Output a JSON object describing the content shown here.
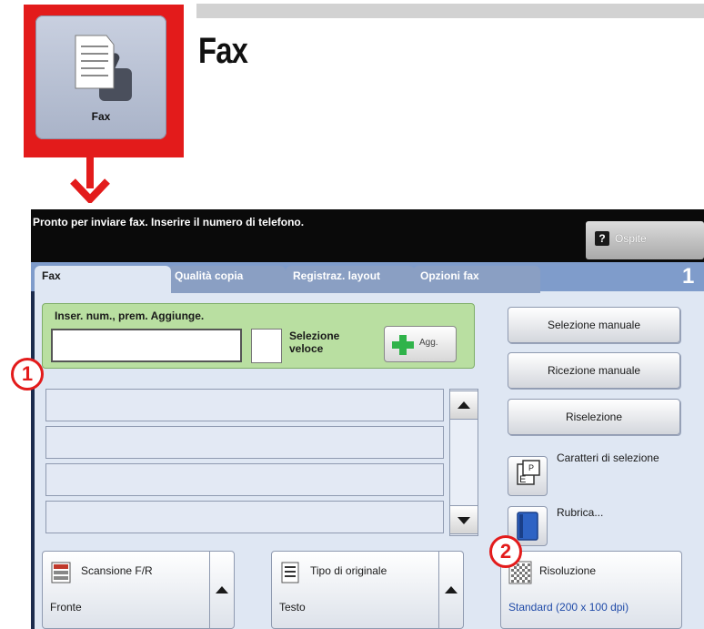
{
  "app_icon": {
    "label": "Fax"
  },
  "page_title": "Fax",
  "colors": {
    "callout": "#e31b1b",
    "tab_bar": "#7f9ccb",
    "entry_area": "#b9dfa1",
    "resolution_value": "#1f4aa8"
  },
  "status_bar": {
    "message": "Pronto per inviare fax. Inserire il numero di telefono.",
    "guest_icon": "question-mark-icon",
    "guest_label": "Ospite"
  },
  "tabs": [
    {
      "label": "Fax",
      "selected": true
    },
    {
      "label": "Qualità copia",
      "selected": false
    },
    {
      "label": "Registraz. layout",
      "selected": false
    },
    {
      "label": "Opzioni fax",
      "selected": false
    }
  ],
  "recipient_count": "1",
  "entry": {
    "label": "Inser. num., prem. Aggiunge.",
    "number_value": "",
    "speed_dial_label": "Selezione veloce",
    "add_button_label": "Agg."
  },
  "recipient_list": {
    "rows": [
      "",
      "",
      "",
      ""
    ]
  },
  "side_buttons": {
    "manual_dial": "Selezione manuale",
    "manual_receive": "Ricezione manuale",
    "redial": "Riselezione",
    "dial_characters": "Caratteri di selezione",
    "address_book": "Rubrica..."
  },
  "settings": [
    {
      "title": "Scansione F/R",
      "value": "Fronte"
    },
    {
      "title": "Tipo di originale",
      "value": "Testo"
    },
    {
      "title": "Risoluzione",
      "value": "Standard (200 x 100 dpi)"
    }
  ],
  "callouts": [
    "1",
    "2"
  ]
}
